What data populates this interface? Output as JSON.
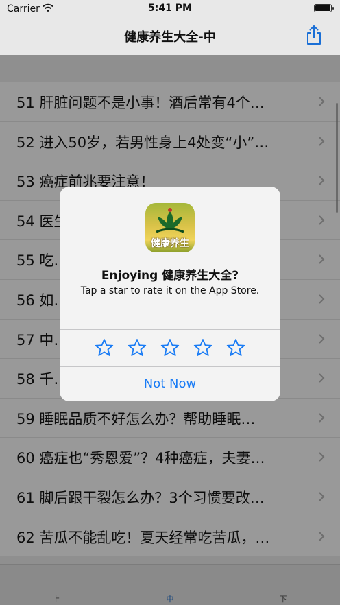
{
  "status_bar": {
    "carrier": "Carrier",
    "time": "5:41 PM"
  },
  "nav": {
    "title": "健康养生大全-中"
  },
  "list": {
    "items": [
      "51 肝脏问题不是小事！酒后常有4个…",
      "52 进入50岁，若男性身上4处变“小”…",
      "53 癌症前兆要注意！",
      "54 医生：…",
      "55 吃…",
      "56 如…",
      "57 中…",
      "58 千…",
      "59 睡眠品质不好怎么办？帮助睡眠…",
      "60 癌症也“秀恩爱”？4种癌症，夫妻…",
      "61 脚后跟干裂怎么办？3个习惯要改…",
      "62 苦瓜不能乱吃！夏天经常吃苦瓜，…"
    ]
  },
  "tabs": [
    {
      "label": "上",
      "active": false
    },
    {
      "label": "中",
      "active": true
    },
    {
      "label": "下",
      "active": false
    }
  ],
  "dialog": {
    "icon_text": "健康养生",
    "title": "Enjoying 健康养生大全?",
    "message": "Tap a star to rate it on the App Store.",
    "stars": 5,
    "dismiss_label": "Not Now"
  },
  "colors": {
    "accent": "#1a7cf5",
    "dim_overlay": "#8f8f8f",
    "dialog_bg": "#f3f3f3"
  }
}
